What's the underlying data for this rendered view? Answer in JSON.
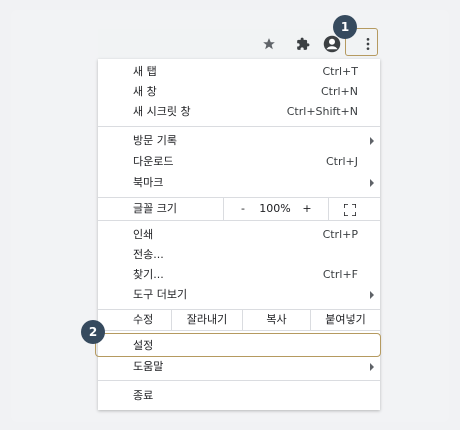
{
  "toolbar": {
    "icons": [
      "star-icon",
      "extensions-puzzle-icon",
      "profile-avatar-icon",
      "more-vert-icon"
    ]
  },
  "menu": {
    "new_tab": {
      "label": "새 탭",
      "shortcut": "Ctrl+T"
    },
    "new_window": {
      "label": "새 창",
      "shortcut": "Ctrl+N"
    },
    "new_incognito": {
      "label": "새 시크릿 창",
      "shortcut": "Ctrl+Shift+N"
    },
    "history": {
      "label": "방문 기록"
    },
    "downloads": {
      "label": "다운로드",
      "shortcut": "Ctrl+J"
    },
    "bookmarks": {
      "label": "북마크"
    },
    "zoom": {
      "label": "글꼴 크기",
      "minus": "-",
      "value": "100%",
      "plus": "+"
    },
    "print": {
      "label": "인쇄",
      "shortcut": "Ctrl+P"
    },
    "cast": {
      "label": "전송..."
    },
    "find": {
      "label": "찾기...",
      "shortcut": "Ctrl+F"
    },
    "more_tools": {
      "label": "도구 더보기"
    },
    "edit": {
      "label": "수정",
      "cut": "잘라내기",
      "copy": "복사",
      "paste": "붙여넣기"
    },
    "settings": {
      "label": "설정"
    },
    "help": {
      "label": "도움말"
    },
    "exit": {
      "label": "종료"
    }
  },
  "badges": {
    "step1": "1",
    "step2": "2"
  },
  "colors": {
    "badge": "#364a5e",
    "highlight_border": "#b59a60",
    "separator": "#dadce0"
  }
}
